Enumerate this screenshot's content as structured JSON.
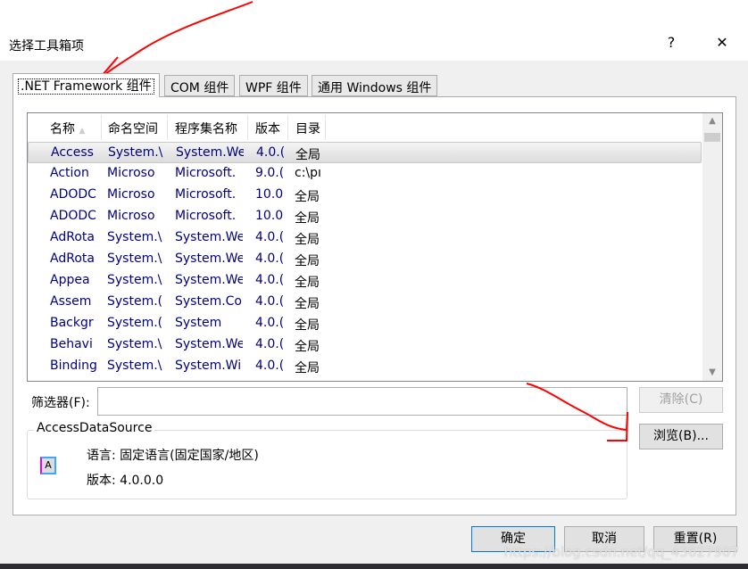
{
  "window": {
    "title": "选择工具箱项",
    "help": "?",
    "close": "✕"
  },
  "tabs": [
    {
      "label": ".NET Framework 组件",
      "active": true
    },
    {
      "label": "COM 组件"
    },
    {
      "label": "WPF 组件"
    },
    {
      "label": "通用 Windows 组件"
    }
  ],
  "list": {
    "columns": [
      "名称",
      "命名空间",
      "程序集名称",
      "版本",
      "目录"
    ],
    "sort_indicator": "▲",
    "rows": [
      [
        "Access",
        "System.\\",
        "System.We",
        "4.0.(",
        "全局"
      ],
      [
        "Action",
        "Microso",
        "Microsoft.",
        "9.0.(",
        "c:\\pı"
      ],
      [
        "ADODC",
        "Microso",
        "Microsoft.",
        "10.0",
        "全局"
      ],
      [
        "ADODC",
        "Microso",
        "Microsoft.",
        "10.0",
        "全局"
      ],
      [
        "AdRota",
        "System.\\",
        "System.We",
        "4.0.(",
        "全局"
      ],
      [
        "AdRota",
        "System.\\",
        "System.We",
        "4.0.(",
        "全局"
      ],
      [
        "Appea",
        "System.\\",
        "System.We",
        "4.0.(",
        "全局"
      ],
      [
        "Assem",
        "System.(",
        "System.Co",
        "4.0.(",
        "全局"
      ],
      [
        "Backgr",
        "System.(",
        "System",
        "4.0.(",
        "全局"
      ],
      [
        "Behavi",
        "System.\\",
        "System.We",
        "4.0.(",
        "全局"
      ],
      [
        "Binding",
        "System.\\",
        "System.Wi",
        "4.0.(",
        "全局"
      ]
    ],
    "selected_index": 0
  },
  "filter": {
    "label": "筛选器(F):",
    "value": ""
  },
  "buttons": {
    "clear": "清除(C)",
    "browse": "浏览(B)...",
    "ok": "确定",
    "cancel": "取消",
    "reset": "重置(R)"
  },
  "details": {
    "name": "AccessDataSource",
    "language_label": "语言:",
    "language": "固定语言(固定国家/地区)",
    "version_label": "版本:",
    "version": "4.0.0.0",
    "icon": "component-icon"
  },
  "watermark": "https://blog.csdn.net/qq_43627907",
  "annotation_color": "#ff0000"
}
